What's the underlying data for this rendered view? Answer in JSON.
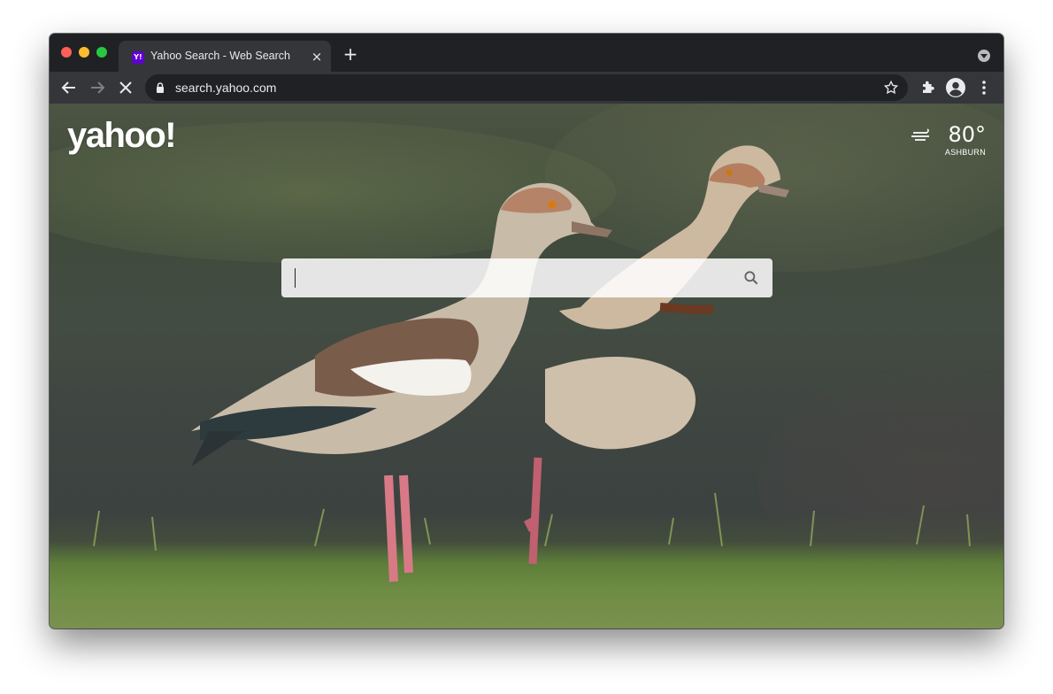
{
  "browser": {
    "tab": {
      "title": "Yahoo Search - Web Search",
      "favicon_text": "Y!"
    },
    "url": "search.yahoo.com",
    "controls": {
      "close_tab_glyph": "×",
      "new_tab_glyph": "+"
    }
  },
  "page": {
    "logo": "yahoo!",
    "weather": {
      "temperature": "80°",
      "location": "ASHBURN",
      "icon": "wind-icon"
    },
    "search": {
      "value": "",
      "placeholder": "",
      "icon": "search-icon"
    }
  },
  "colors": {
    "yahoo_purple": "#6001d2",
    "chrome_dark": "#202124",
    "toolbar": "#35363a"
  }
}
